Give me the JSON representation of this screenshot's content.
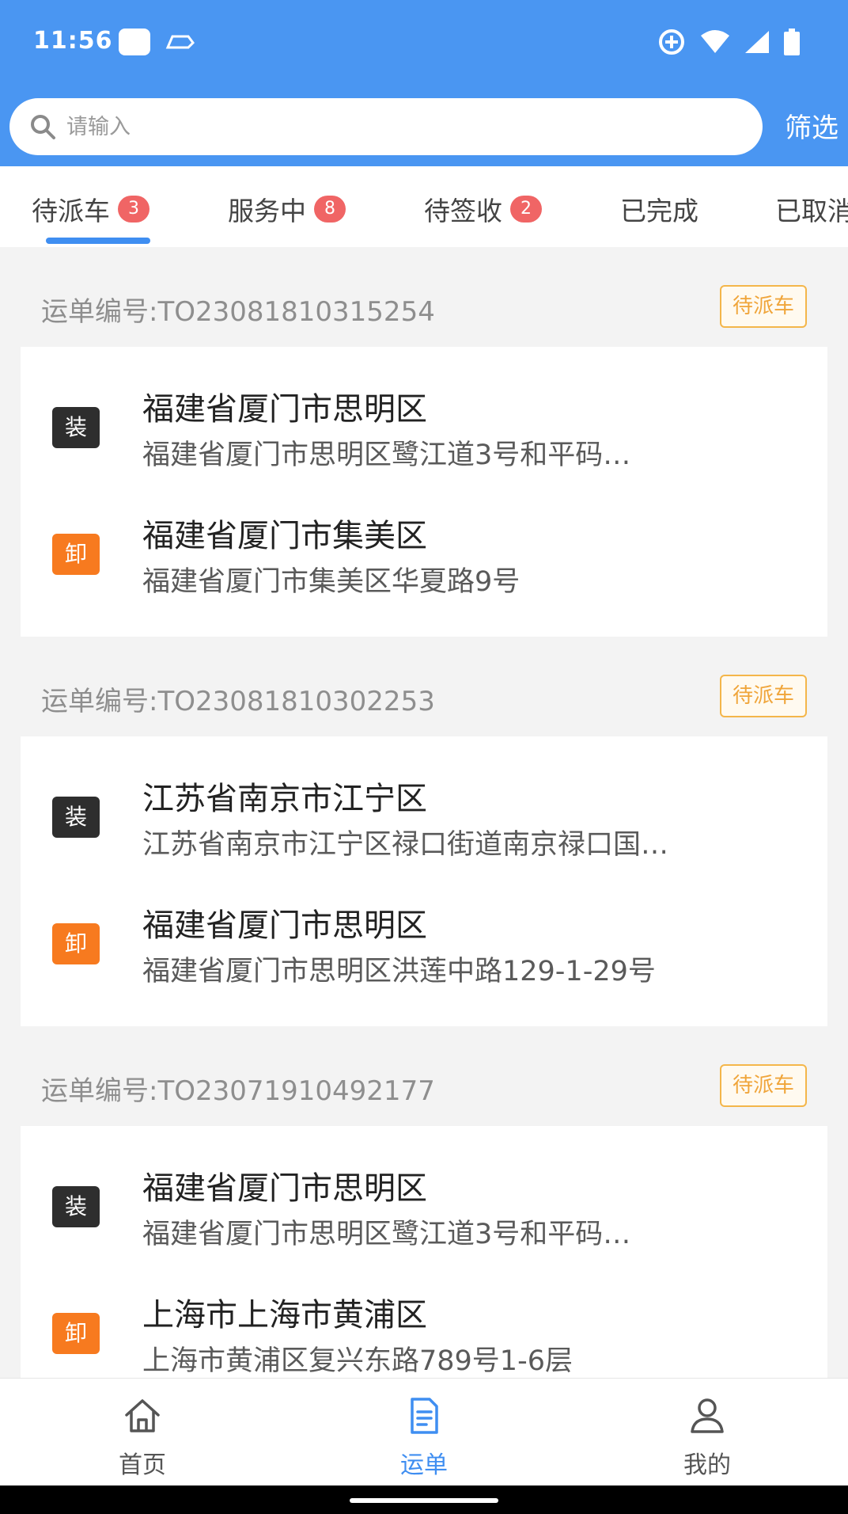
{
  "status_bar": {
    "time": "11:56"
  },
  "search": {
    "placeholder": "请输入",
    "filter_label": "筛选"
  },
  "tabs": [
    {
      "label": "待派车",
      "badge": "3",
      "active": true
    },
    {
      "label": "服务中",
      "badge": "8"
    },
    {
      "label": "待签收",
      "badge": "2"
    },
    {
      "label": "已完成"
    },
    {
      "label": "已取消"
    }
  ],
  "orders": [
    {
      "order_no": "运单编号:TO23081810315254",
      "status": "待派车",
      "load": {
        "tag": "装",
        "region": "福建省厦门市思明区",
        "address": "福建省厦门市思明区鹭江道3号和平码…"
      },
      "unload": {
        "tag": "卸",
        "region": "福建省厦门市集美区",
        "address": "福建省厦门市集美区华夏路9号"
      }
    },
    {
      "order_no": "运单编号:TO23081810302253",
      "status": "待派车",
      "load": {
        "tag": "装",
        "region": "江苏省南京市江宁区",
        "address": "江苏省南京市江宁区禄口街道南京禄口国…"
      },
      "unload": {
        "tag": "卸",
        "region": "福建省厦门市思明区",
        "address": "福建省厦门市思明区洪莲中路129-1-29号"
      }
    },
    {
      "order_no": "运单编号:TO23071910492177",
      "status": "待派车",
      "load": {
        "tag": "装",
        "region": "福建省厦门市思明区",
        "address": "福建省厦门市思明区鹭江道3号和平码…"
      },
      "unload": {
        "tag": "卸",
        "region": "上海市上海市黄浦区",
        "address": "上海市黄浦区复兴东路789号1-6层"
      }
    }
  ],
  "bottom_nav": [
    {
      "label": "首页",
      "icon": "home-icon"
    },
    {
      "label": "运单",
      "icon": "waybill-icon",
      "active": true
    },
    {
      "label": "我的",
      "icon": "user-icon"
    }
  ],
  "colors": {
    "primary": "#4a96f2",
    "badge": "#f06565",
    "status_border": "#f4b64a",
    "load_tag": "#2e2e2e",
    "unload_tag": "#f77a1f"
  }
}
